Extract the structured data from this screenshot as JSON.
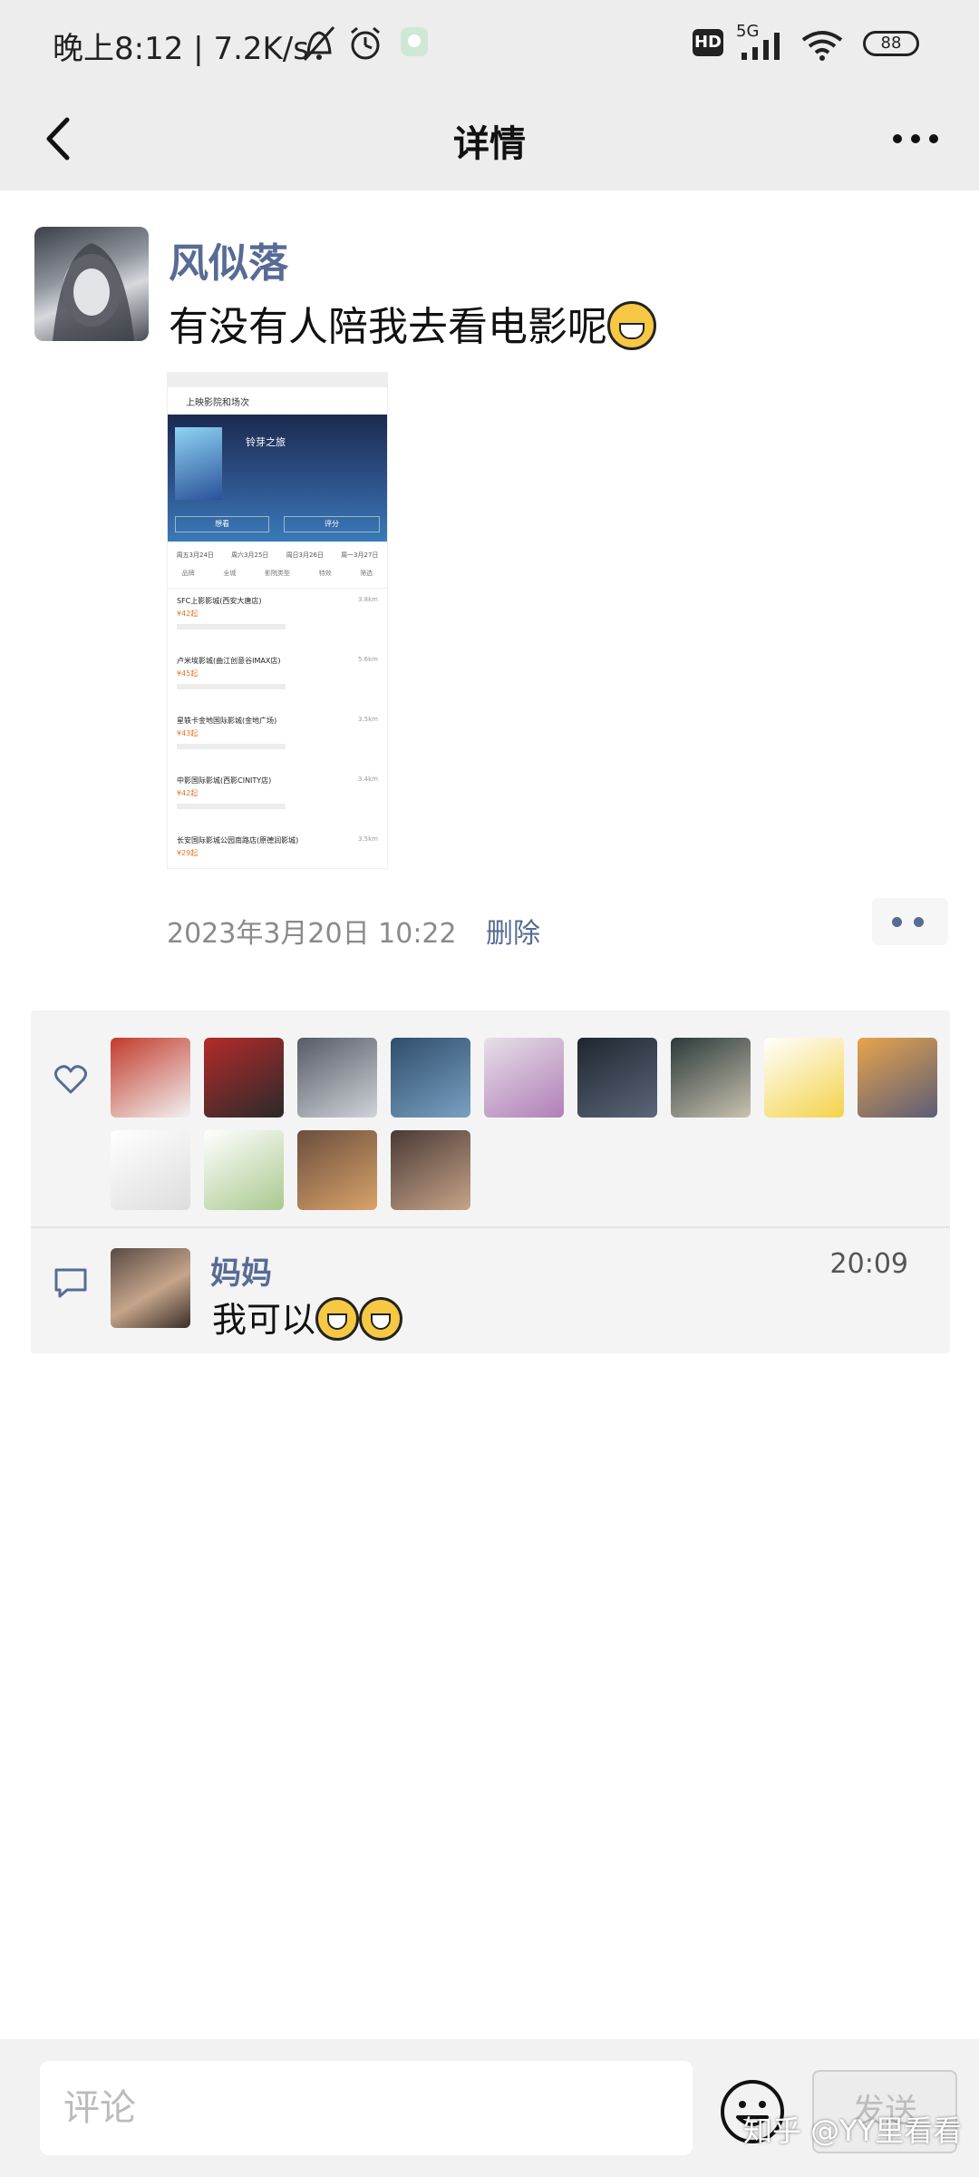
{
  "status_bar": {
    "time_text": "晚上8:12",
    "net_speed": "7.2K/s",
    "hd_label": "HD",
    "network_label": "5G",
    "battery": "88"
  },
  "nav": {
    "title": "详情"
  },
  "post": {
    "author": "风似落",
    "text": "有没有人陪我去看电影呢",
    "time": "2023年3月20日 10:22",
    "delete_label": "删除",
    "image": {
      "header": "上映影院和场次",
      "movie_title": "铃芽之旅",
      "button_left": "想看",
      "button_right": "评分",
      "dates": [
        "周五3月24日",
        "周六3月25日",
        "周日3月26日",
        "周一3月27日"
      ],
      "filters": [
        "品牌",
        "全城",
        "影院类型",
        "特效",
        "筛选"
      ],
      "cinemas": [
        {
          "name": "SFC上影影城(西安大唐店)",
          "price": "¥42起",
          "dist": "3.8km"
        },
        {
          "name": "卢米埃影城(曲江创意谷IMAX店)",
          "price": "¥45起",
          "dist": "5.6km"
        },
        {
          "name": "星轶卡金地国际影城(金地广场)",
          "price": "¥43起",
          "dist": "3.5km"
        },
        {
          "name": "中影国际影城(西影CINITY店)",
          "price": "¥42起",
          "dist": "3.4km"
        },
        {
          "name": "长安国际影城公园南路店(原德润影城)",
          "price": "¥29起",
          "dist": "3.5km"
        }
      ]
    }
  },
  "likes": {
    "count_visible": 13,
    "avatar_colors": [
      [
        "#c23a2b",
        "#f2f2f2"
      ],
      [
        "#b52a2a",
        "#2a2a2a"
      ],
      [
        "#555b66",
        "#d0d3d8"
      ],
      [
        "#2f4d6b",
        "#7aa0c2"
      ],
      [
        "#e7dfe8",
        "#b07fb7"
      ],
      [
        "#1f2630",
        "#5b6677"
      ],
      [
        "#2b3a3a",
        "#c9c2b0"
      ],
      [
        "#ffffff",
        "#f3d34a"
      ],
      [
        "#e8a44b",
        "#5b5d77"
      ],
      [
        "#ffffff",
        "#dddddd"
      ],
      [
        "#ffffff",
        "#a9c98f"
      ],
      [
        "#6b4e3d",
        "#d9a36a"
      ],
      [
        "#4a3a35",
        "#c7a489"
      ]
    ]
  },
  "comment": {
    "author": "妈妈",
    "time": "20:09",
    "text": "我可以"
  },
  "input_bar": {
    "placeholder": "评论",
    "send_label": "发送"
  },
  "watermark": "知乎 @YY里看看",
  "colors": {
    "link_blue": "#576b95",
    "bar_gray": "#ededed",
    "panel_gray": "#f4f4f4"
  }
}
